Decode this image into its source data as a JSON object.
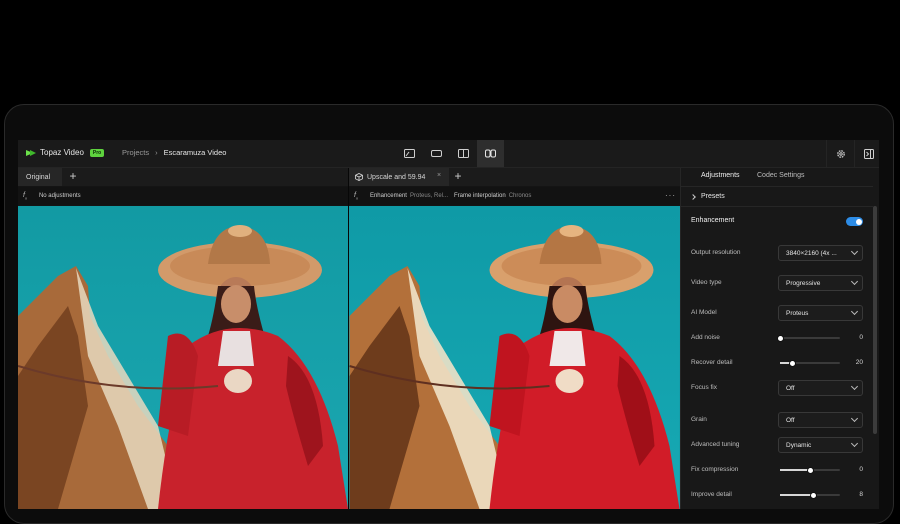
{
  "app": {
    "name": "Topaz Video",
    "badge": "Pro"
  },
  "breadcrumb": {
    "projects": "Projects",
    "separator": "›",
    "current": "Escaramuza Video"
  },
  "left_pane": {
    "tab_label": "Original",
    "add_symbol": "+",
    "info": "No adjustments"
  },
  "right_pane": {
    "tab_label": "Upscale and 59.94",
    "close_symbol": "×",
    "add_symbol": "+",
    "info": {
      "enh_label": "Enhancement",
      "enh_value": "Proteus, Rel...",
      "fi_label": "Frame interpolation",
      "fi_value": "Chronos"
    },
    "more": "···"
  },
  "panel": {
    "tabs": [
      "Adjustments",
      "Codec Settings"
    ],
    "presets_label": "Presets",
    "enhancement_label": "Enhancement",
    "enhancement_enabled": true,
    "rows": [
      {
        "label": "Output resolution",
        "kind": "select",
        "value": "3840×2160 (4x ..."
      },
      {
        "label": "Video type",
        "kind": "select",
        "value": "Progressive"
      },
      {
        "label": "AI Model",
        "kind": "select",
        "value": "Proteus"
      },
      {
        "label": "Add noise",
        "kind": "slider",
        "value": "0",
        "fraction": 0.0
      },
      {
        "label": "Recover detail",
        "kind": "slider",
        "value": "20",
        "fraction": 0.2
      },
      {
        "label": "Focus fix",
        "kind": "select",
        "value": "Off"
      },
      {
        "label": "Grain",
        "kind": "select",
        "value": "Off"
      },
      {
        "label": "Advanced tuning",
        "kind": "select",
        "value": "Dynamic"
      },
      {
        "label": "Fix compression",
        "kind": "slider",
        "value": "0",
        "fraction": 0.5
      },
      {
        "label": "Improve detail",
        "kind": "slider",
        "value": "8",
        "fraction": 0.55
      }
    ]
  },
  "colors": {
    "accent_green": "#5ed33e",
    "toggle_blue": "#2d8ce6",
    "video_sky": "#149aa5"
  }
}
